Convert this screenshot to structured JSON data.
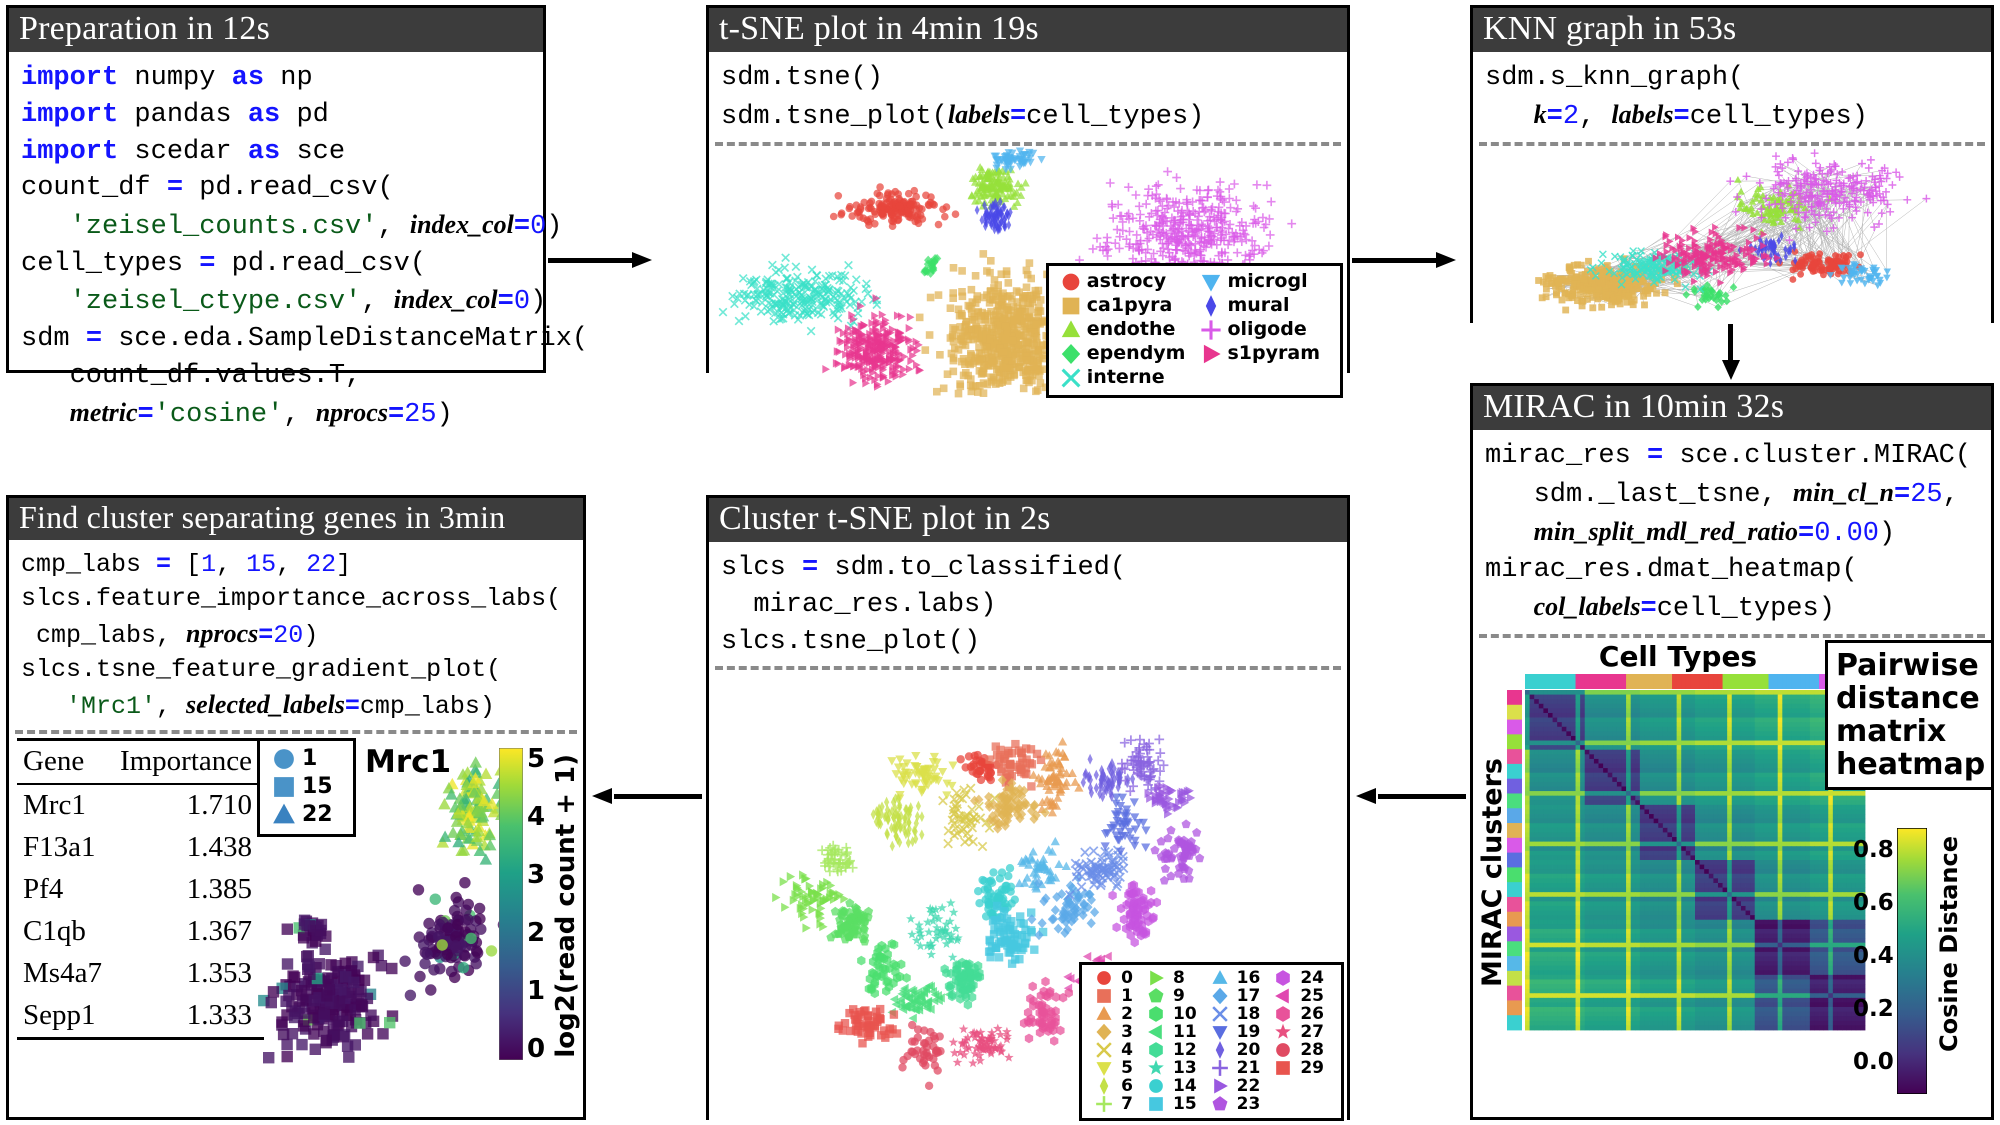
{
  "panels": {
    "preparation": {
      "title": "Preparation in 12s",
      "code_lines": [
        "import numpy as np",
        "import pandas as pd",
        "import scedar as sce",
        "count_df = pd.read_csv(",
        "   'zeisel_counts.csv', index_col=0)",
        "cell_types = pd.read_csv(",
        "   'zeisel_ctype.csv', index_col=0)",
        "sdm = sce.eda.SampleDistanceMatrix(",
        "   count_df.values.T,",
        "   metric='cosine', nprocs=25)"
      ]
    },
    "tsne": {
      "title": "t-SNE plot in 4min 19s",
      "code_lines": [
        "sdm.tsne()",
        "sdm.tsne_plot(labels=cell_types)"
      ],
      "legend": [
        {
          "label": "astrocy",
          "marker": "circle",
          "color": "#e8453c"
        },
        {
          "label": "ca1pyra",
          "marker": "square",
          "color": "#e0b354"
        },
        {
          "label": "endothe",
          "marker": "triangle-up",
          "color": "#96e03a"
        },
        {
          "label": "ependym",
          "marker": "diamond",
          "color": "#3ce06a"
        },
        {
          "label": "interne",
          "marker": "x",
          "color": "#3ae0c8"
        },
        {
          "label": "microgl",
          "marker": "triangle-down",
          "color": "#4fb4ef"
        },
        {
          "label": "mural",
          "marker": "thin-diamond",
          "color": "#4a48e8"
        },
        {
          "label": "oligode",
          "marker": "plus",
          "color": "#d95ae8"
        },
        {
          "label": "s1pyram",
          "marker": "triangle-right",
          "color": "#e8368f"
        }
      ]
    },
    "knn": {
      "title": "KNN graph in 53s",
      "code_lines": [
        "sdm.s_knn_graph(",
        "   k=2, labels=cell_types)"
      ]
    },
    "mirac": {
      "title": "MIRAC in 10min 32s",
      "code_lines": [
        "mirac_res = sce.cluster.MIRAC(",
        "   sdm._last_tsne, min_cl_n=25,",
        "   min_split_mdl_red_ratio=0.00)",
        "mirac_res.dmat_heatmap(",
        "   col_labels=cell_types)"
      ],
      "heatmap_col_title": "Cell Types",
      "heatmap_row_title": "MIRAC clusters",
      "callout": "Pairwise distance matrix heatmap",
      "colorbar": {
        "label": "Cosine Distance",
        "ticks": [
          "0.8",
          "0.6",
          "0.4",
          "0.2",
          "0.0"
        ],
        "min": 0.0,
        "max": 1.0
      }
    },
    "cluster_tsne": {
      "title": "Cluster t-SNE plot in 2s",
      "code_lines": [
        "slcs = sdm.to_classified(",
        "  mirac_res.labs)",
        "slcs.tsne_plot()"
      ],
      "legend": [
        {
          "label": "0",
          "marker": "circle",
          "color": "#e8453c"
        },
        {
          "label": "1",
          "marker": "square",
          "color": "#e8705a"
        },
        {
          "label": "2",
          "marker": "triangle-up",
          "color": "#e89a50"
        },
        {
          "label": "3",
          "marker": "diamond",
          "color": "#e0b354"
        },
        {
          "label": "4",
          "marker": "x",
          "color": "#d8c94a"
        },
        {
          "label": "5",
          "marker": "triangle-down",
          "color": "#dbe04a"
        },
        {
          "label": "6",
          "marker": "thin-diamond",
          "color": "#c3e048"
        },
        {
          "label": "7",
          "marker": "plus",
          "color": "#a6e860"
        },
        {
          "label": "8",
          "marker": "triangle-right",
          "color": "#7ae04a"
        },
        {
          "label": "9",
          "marker": "pentagon",
          "color": "#5ade64"
        },
        {
          "label": "10",
          "marker": "hexagon",
          "color": "#4ade6e"
        },
        {
          "label": "11",
          "marker": "triangle-left",
          "color": "#4ade7e"
        },
        {
          "label": "12",
          "marker": "hexagon",
          "color": "#44dc96"
        },
        {
          "label": "13",
          "marker": "star",
          "color": "#40d8b0"
        },
        {
          "label": "14",
          "marker": "circle",
          "color": "#3ad0d0"
        },
        {
          "label": "15",
          "marker": "square",
          "color": "#46c8e0"
        },
        {
          "label": "16",
          "marker": "triangle-up",
          "color": "#56b8e8"
        },
        {
          "label": "17",
          "marker": "diamond",
          "color": "#5aa8e8"
        },
        {
          "label": "18",
          "marker": "x",
          "color": "#6a8ee8"
        },
        {
          "label": "19",
          "marker": "triangle-down",
          "color": "#5a6ee0"
        },
        {
          "label": "20",
          "marker": "thin-diamond",
          "color": "#7060e0"
        },
        {
          "label": "21",
          "marker": "plus",
          "color": "#8a64e0"
        },
        {
          "label": "22",
          "marker": "triangle-right",
          "color": "#9a58e0"
        },
        {
          "label": "23",
          "marker": "pentagon",
          "color": "#b055e0"
        },
        {
          "label": "24",
          "marker": "hexagon",
          "color": "#c754e0"
        },
        {
          "label": "25",
          "marker": "triangle-left",
          "color": "#e048b0"
        },
        {
          "label": "26",
          "marker": "hexagon",
          "color": "#e8529a"
        },
        {
          "label": "27",
          "marker": "star",
          "color": "#e85080"
        },
        {
          "label": "28",
          "marker": "circle",
          "color": "#e04a62"
        },
        {
          "label": "29",
          "marker": "square",
          "color": "#e8544e"
        }
      ]
    },
    "genes": {
      "title": "Find cluster separating genes in 3min",
      "code_lines": [
        "cmp_labs = [1, 15, 22]",
        "slcs.feature_importance_across_labs(",
        " cmp_labs, nprocs=20)",
        "slcs.tsne_feature_gradient_plot(",
        "   'Mrc1', selected_labels=cmp_labs)"
      ],
      "table": {
        "headers": [
          "Gene",
          "Importance"
        ],
        "rows": [
          [
            "Mrc1",
            "1.710"
          ],
          [
            "F13a1",
            "1.438"
          ],
          [
            "Pf4",
            "1.385"
          ],
          [
            "C1qb",
            "1.367"
          ],
          [
            "Ms4a7",
            "1.353"
          ],
          [
            "Sepp1",
            "1.333"
          ]
        ]
      },
      "gradient_plot": {
        "title": "Mrc1",
        "legend": [
          {
            "label": "1",
            "marker": "circle",
            "color": "#4a93c8"
          },
          {
            "label": "15",
            "marker": "square",
            "color": "#4a93c8"
          },
          {
            "label": "22",
            "marker": "triangle-up",
            "color": "#3a82c0"
          }
        ],
        "colorbar": {
          "label": "log2(read count + 1)",
          "ticks": [
            "5",
            "4",
            "3",
            "2",
            "1",
            "0"
          ],
          "min": 0,
          "max": 5.4
        }
      }
    }
  },
  "arrows": [
    {
      "name": "prep-to-tsne",
      "direction": "right"
    },
    {
      "name": "tsne-to-knn",
      "direction": "right"
    },
    {
      "name": "knn-to-mirac",
      "direction": "down"
    },
    {
      "name": "mirac-to-cluster",
      "direction": "left"
    },
    {
      "name": "cluster-to-genes",
      "direction": "left"
    }
  ],
  "colors": {
    "header_bg": "#3c3c3c",
    "header_fg": "#ffffff",
    "border": "#000000",
    "keyword": "#1414ff",
    "string": "#0a5a19",
    "dashed_rule": "#8a8a8a"
  }
}
